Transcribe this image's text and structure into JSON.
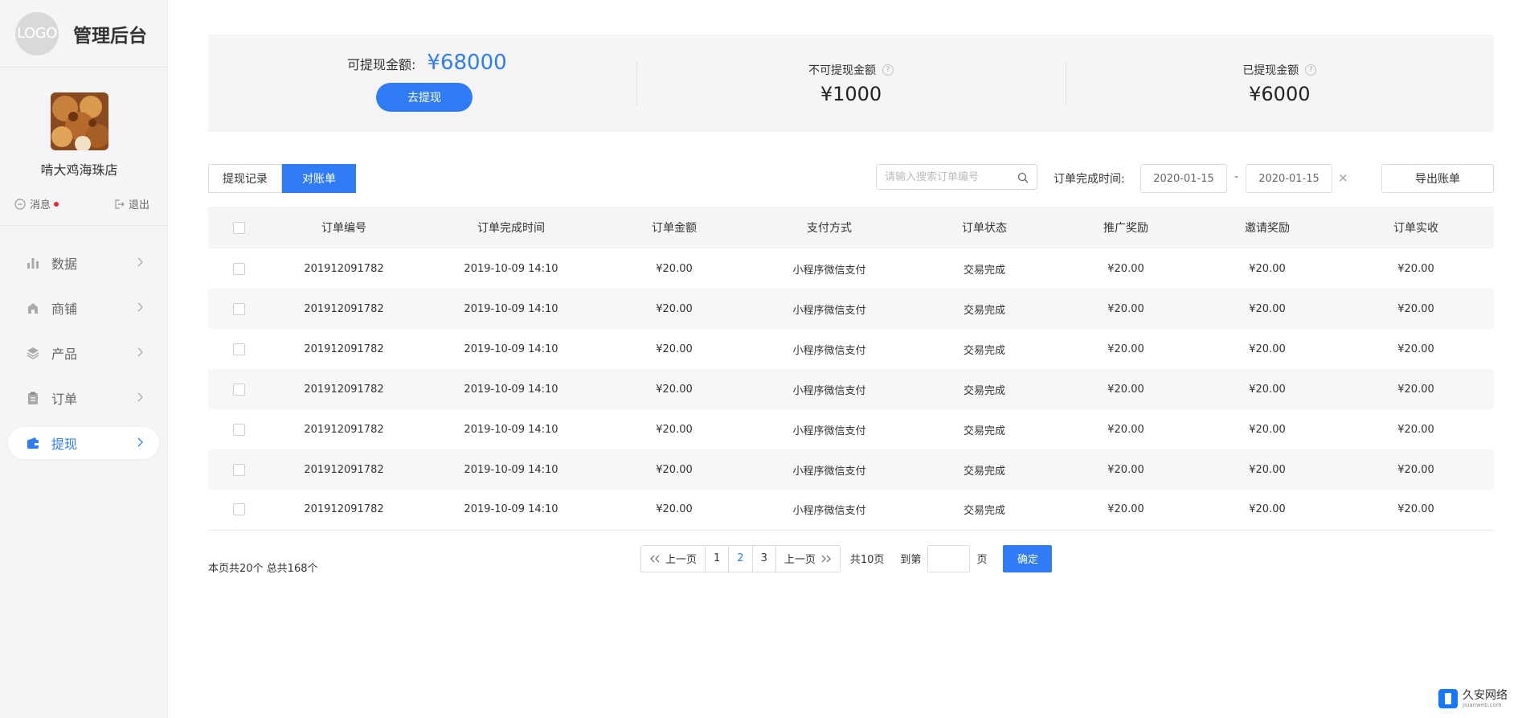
{
  "brand": {
    "logo_text": "LOGO",
    "title": "管理后台"
  },
  "profile": {
    "shop_name": "啃大鸡海珠店",
    "message_label": "消息",
    "logout_label": "退出"
  },
  "menu": [
    {
      "label": "数据",
      "icon": "bar-chart-icon",
      "active": false
    },
    {
      "label": "商铺",
      "icon": "shop-icon",
      "active": false
    },
    {
      "label": "产品",
      "icon": "layers-icon",
      "active": false
    },
    {
      "label": "订单",
      "icon": "clipboard-icon",
      "active": false
    },
    {
      "label": "提现",
      "icon": "wallet-icon",
      "active": true
    }
  ],
  "summary": {
    "available_label": "可提现金额:",
    "available_amount": "¥68000",
    "withdraw_button": "去提现",
    "unavailable_label": "不可提现金额",
    "unavailable_amount": "¥1000",
    "withdrawn_label": "已提现金额",
    "withdrawn_amount": "¥6000",
    "help_icon_text": "?"
  },
  "toolbar": {
    "tabs": [
      "提现记录",
      "对账单"
    ],
    "active_tab": "对账单",
    "search_placeholder": "请输入搜索订单编号",
    "date_label": "订单完成时间:",
    "date_start": "2020-01-15",
    "date_separator": "-",
    "date_end": "2020-01-15",
    "clear_icon": "×",
    "export_label": "导出账单"
  },
  "table": {
    "headers": [
      "订单编号",
      "订单完成时间",
      "订单金额",
      "支付方式",
      "订单状态",
      "推广奖励",
      "邀请奖励",
      "订单实收"
    ],
    "rows": [
      [
        "201912091782",
        "2019-10-09 14:10",
        "¥20.00",
        "小程序微信支付",
        "交易完成",
        "¥20.00",
        "¥20.00",
        "¥20.00"
      ],
      [
        "201912091782",
        "2019-10-09 14:10",
        "¥20.00",
        "小程序微信支付",
        "交易完成",
        "¥20.00",
        "¥20.00",
        "¥20.00"
      ],
      [
        "201912091782",
        "2019-10-09 14:10",
        "¥20.00",
        "小程序微信支付",
        "交易完成",
        "¥20.00",
        "¥20.00",
        "¥20.00"
      ],
      [
        "201912091782",
        "2019-10-09 14:10",
        "¥20.00",
        "小程序微信支付",
        "交易完成",
        "¥20.00",
        "¥20.00",
        "¥20.00"
      ],
      [
        "201912091782",
        "2019-10-09 14:10",
        "¥20.00",
        "小程序微信支付",
        "交易完成",
        "¥20.00",
        "¥20.00",
        "¥20.00"
      ],
      [
        "201912091782",
        "2019-10-09 14:10",
        "¥20.00",
        "小程序微信支付",
        "交易完成",
        "¥20.00",
        "¥20.00",
        "¥20.00"
      ],
      [
        "201912091782",
        "2019-10-09 14:10",
        "¥20.00",
        "小程序微信支付",
        "交易完成",
        "¥20.00",
        "¥20.00",
        "¥20.00"
      ]
    ]
  },
  "pagination": {
    "count_text": "本页共20个  总共168个",
    "prev_label": "上一页",
    "pages": [
      "1",
      "2",
      "3"
    ],
    "current_page": "2",
    "next_label": "上一页",
    "total_pages_text": "共10页",
    "goto_label": "到第",
    "goto_unit": "页",
    "confirm_label": "确定"
  },
  "watermark": {
    "title": "久安网络",
    "url": "jiuanweb.com"
  },
  "colors": {
    "accent": "#2f7cf6",
    "sidebar_bg": "#f5f5f7",
    "dot_red": "#f5222d"
  }
}
